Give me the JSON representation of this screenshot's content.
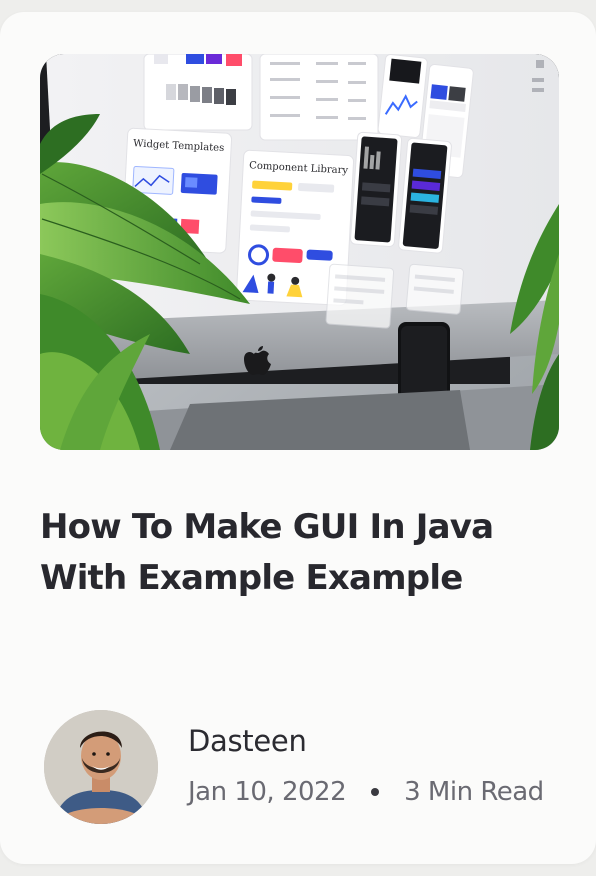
{
  "article": {
    "title": "How To Make GUI In Java With Example Example",
    "author": "Dasteen",
    "date": "Jan 10, 2022",
    "read_time": "3 Min Read",
    "hero_labels": {
      "widget_templates": "Widget Templates",
      "component_library": "Component Library"
    }
  },
  "colors": {
    "title": "#28282e",
    "meta": "#6a6a72",
    "card_background": "#fbfbfa"
  }
}
